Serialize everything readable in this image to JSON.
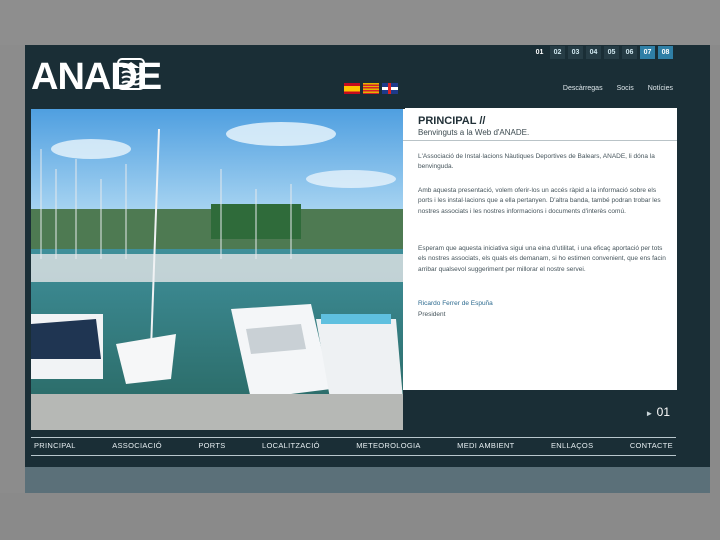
{
  "brand": {
    "name": "ANADE"
  },
  "page_numbers": [
    "01",
    "02",
    "03",
    "04",
    "05",
    "06",
    "07",
    "08"
  ],
  "top_nav": [
    "Descàrregas",
    "Socis",
    "Notícies"
  ],
  "flags": [
    "flag-spain-icon",
    "flag-catalonia-icon",
    "flag-uk-icon"
  ],
  "content": {
    "title": "PRINCIPAL //",
    "subtitle": "Benvinguts a la Web d'ANADE.",
    "p1": "L'Associació de Instal·lacions Nàutiques Deportives de Balears, ANADE, li dóna la benvinguda.",
    "p2": "Amb aquesta presentació, volem oferir-los un accés ràpid a la informació sobre els ports i les instal·lacions que a ella pertanyen. D'altra banda, també podran trobar les nostres associats i les nostres informacions i documents d'interès comú.",
    "p3": "Esperam que aquesta iniciativa sigui una eina d'utilitat, i una eficaç aportació per tots els nostres associats, els quals els demanam, si ho estimen convenient, que ens facin arribar qualsevol suggeriment per millorar el nostre servei.",
    "signature_name": "Ricardo Ferrer de Espuña",
    "signature_role": "President"
  },
  "pager": {
    "label": "01"
  },
  "main_nav": [
    "PRINCIPAL",
    "ASSOCIACIÓ",
    "PORTS",
    "LOCALITZACIÓ",
    "METEOROLOGIA",
    "MEDI AMBIENT",
    "ENLLAÇOS",
    "CONTACTE"
  ]
}
